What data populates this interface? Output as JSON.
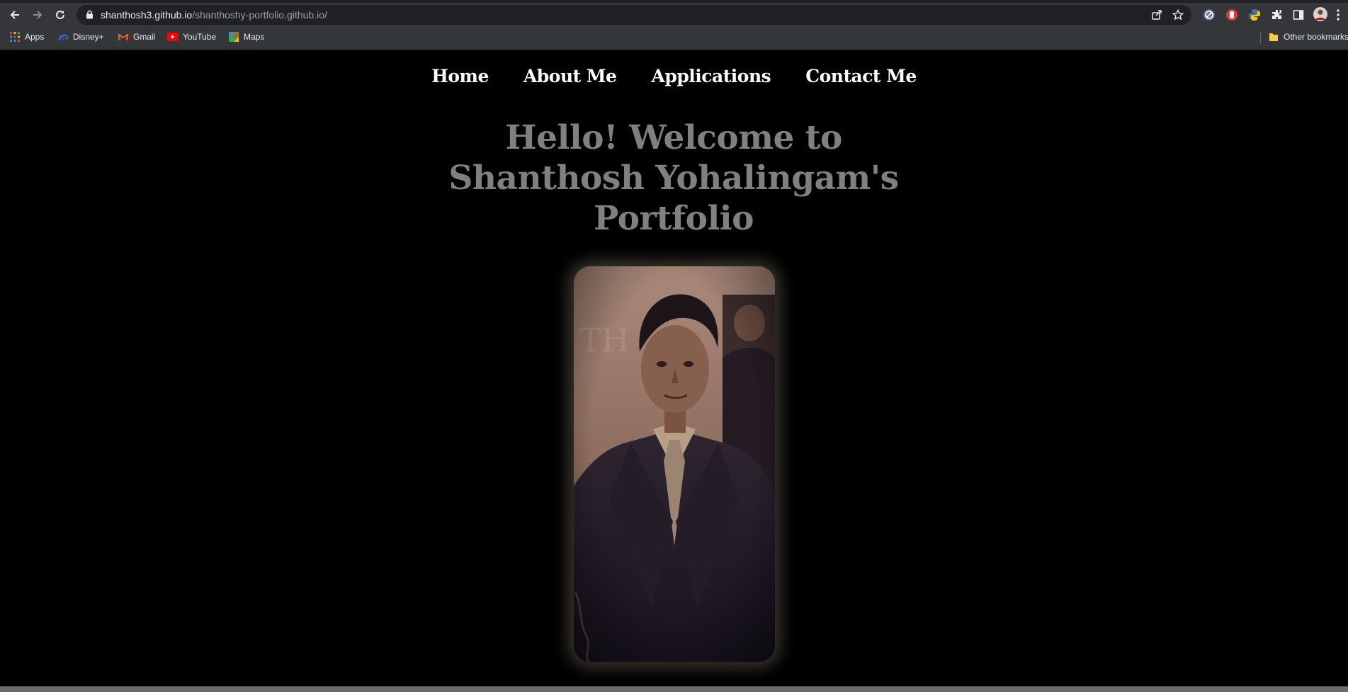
{
  "browser": {
    "url_host": "shanthosh3.github.io",
    "url_path": "/shanthoshy-portfolio.github.io/",
    "bookmarks": [
      {
        "label": "Apps",
        "icon": "apps-grid-icon"
      },
      {
        "label": "Disney+",
        "icon": "disney-plus-icon"
      },
      {
        "label": "Gmail",
        "icon": "gmail-icon"
      },
      {
        "label": "YouTube",
        "icon": "youtube-icon"
      },
      {
        "label": "Maps",
        "icon": "google-maps-icon"
      }
    ],
    "other_bookmarks": "Other bookmarks"
  },
  "nav": {
    "items": [
      "Home",
      "About Me",
      "Applications",
      "Contact Me"
    ]
  },
  "hero": {
    "title": "Hello! Welcome to Shanthosh Yohalingam's Portfolio"
  },
  "colors": {
    "page_background": "#000000",
    "nav_text": "#ffffff",
    "title_text": "#808080",
    "chrome_toolbar": "#35363a",
    "omnibox": "#202124"
  }
}
